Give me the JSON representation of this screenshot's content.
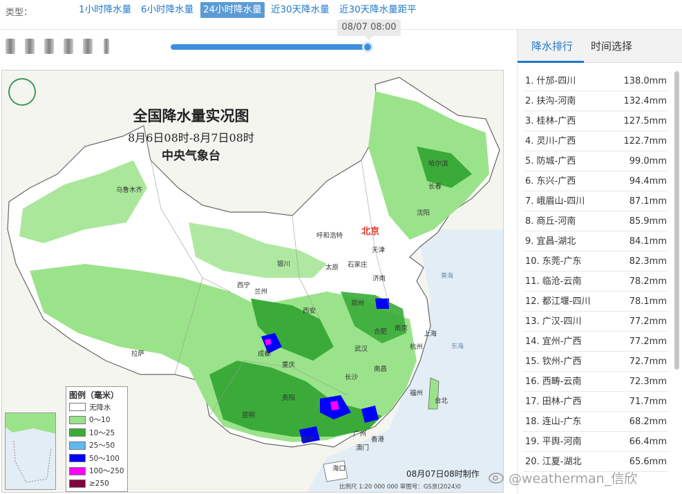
{
  "type_bar": {
    "label": "类型：",
    "tabs": [
      {
        "label": "1小时降水量",
        "active": false
      },
      {
        "label": "6小时降水量",
        "active": false
      },
      {
        "label": "24小时降水量",
        "active": true
      },
      {
        "label": "近30天降水量",
        "active": false
      },
      {
        "label": "近30天降水量距平",
        "active": false
      }
    ]
  },
  "timeline": {
    "current": "08/07 08:00",
    "progress": 0.99
  },
  "map": {
    "title": "全国降水量实况图",
    "period": "8月6日08时-8月7日08时",
    "agency": "中央气象台",
    "made_at": "08月07日08时制作",
    "scale": "比例尺 1:20 000 000   审图号：GS京(2024)0",
    "capital": "北京",
    "cities": [
      "乌鲁木齐",
      "哈尔滨",
      "长春",
      "沈阳",
      "呼和浩特",
      "天津",
      "银川",
      "太原",
      "石家庄",
      "济南",
      "西宁",
      "兰州",
      "西安",
      "郑州",
      "南京",
      "上海",
      "合肥",
      "武汉",
      "杭州",
      "成都",
      "重庆",
      "拉萨",
      "长沙",
      "南昌",
      "贵阳",
      "福州",
      "台北",
      "昆明",
      "南宁",
      "广州",
      "香港",
      "澳门",
      "海口"
    ],
    "seas": [
      "东海",
      "黄海"
    ],
    "legend": {
      "title": "图例（毫米）",
      "items": [
        {
          "label": "无降水",
          "color": "#ffffff"
        },
        {
          "label": "0～10",
          "color": "#9be38a"
        },
        {
          "label": "10～25",
          "color": "#3aab39"
        },
        {
          "label": "25～50",
          "color": "#62b8f0"
        },
        {
          "label": "50～100",
          "color": "#0000ff"
        },
        {
          "label": "100～250",
          "color": "#ff00ff"
        },
        {
          "label": "≥250",
          "color": "#800040"
        }
      ]
    }
  },
  "sidebar": {
    "tabs": [
      {
        "label": "降水排行",
        "active": true
      },
      {
        "label": "时间选择",
        "active": false
      }
    ],
    "ranking": [
      {
        "place": "1. 什邡-四川",
        "value": "138.0mm"
      },
      {
        "place": "2. 扶沟-河南",
        "value": "132.4mm"
      },
      {
        "place": "3. 桂林-广西",
        "value": "127.5mm"
      },
      {
        "place": "4. 灵川-广西",
        "value": "122.7mm"
      },
      {
        "place": "5. 防城-广西",
        "value": "99.0mm"
      },
      {
        "place": "6. 东兴-广西",
        "value": "94.4mm"
      },
      {
        "place": "7. 峨眉山-四川",
        "value": "87.1mm"
      },
      {
        "place": "8. 商丘-河南",
        "value": "85.9mm"
      },
      {
        "place": "9. 宜昌-湖北",
        "value": "84.1mm"
      },
      {
        "place": "10. 东莞-广东",
        "value": "82.3mm"
      },
      {
        "place": "11. 临沧-云南",
        "value": "78.2mm"
      },
      {
        "place": "12. 都江堰-四川",
        "value": "78.1mm"
      },
      {
        "place": "13. 广汉-四川",
        "value": "77.2mm"
      },
      {
        "place": "14. 宜州-广西",
        "value": "77.2mm"
      },
      {
        "place": "15. 钦州-广西",
        "value": "72.7mm"
      },
      {
        "place": "16. 西畴-云南",
        "value": "72.3mm"
      },
      {
        "place": "17. 田林-广西",
        "value": "71.7mm"
      },
      {
        "place": "18. 连山-广东",
        "value": "68.2mm"
      },
      {
        "place": "19. 平舆-河南",
        "value": "66.4mm"
      },
      {
        "place": "20. 江夏-湖北",
        "value": "65.6mm"
      }
    ]
  },
  "watermark": "@weatherman_信欣"
}
